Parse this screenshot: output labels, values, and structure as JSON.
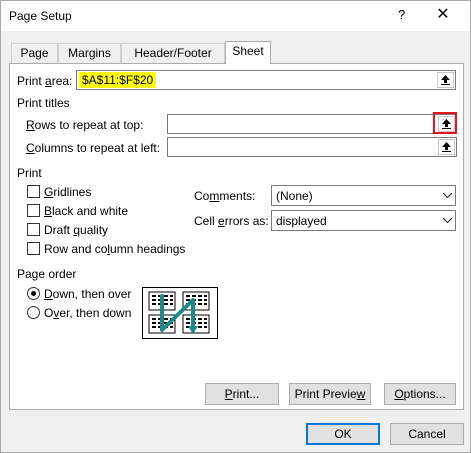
{
  "window": {
    "title": "Page Setup",
    "help": "?",
    "close": "✕"
  },
  "tabs": [
    {
      "label": "Page"
    },
    {
      "label": "Margins"
    },
    {
      "label": "Header/Footer"
    },
    {
      "label": "Sheet",
      "active": true
    }
  ],
  "print_area": {
    "label_pre": "Print ",
    "label_u": "a",
    "label_post": "rea:",
    "value": "$A$11:$F$20",
    "highlight_color": "#ffff00"
  },
  "print_titles": {
    "heading": "Print titles",
    "rows": {
      "label_u": "R",
      "label_post": "ows to repeat at top:",
      "value": ""
    },
    "columns": {
      "label_u": "C",
      "label_post": "olumns to repeat at left:",
      "value": ""
    }
  },
  "print": {
    "heading": "Print",
    "checkboxes": [
      {
        "u": "G",
        "rest": "ridlines",
        "checked": false
      },
      {
        "u": "B",
        "rest": "lack and white",
        "checked": false
      },
      {
        "pre": "Draft ",
        "u": "q",
        "rest": "uality",
        "checked": false
      },
      {
        "pre": "Row and co",
        "u": "l",
        "rest": "umn headings",
        "checked": false
      }
    ],
    "comments": {
      "pre": "Co",
      "u": "m",
      "rest": "ments:",
      "value": "(None)"
    },
    "cell_errors": {
      "pre": "Cell ",
      "u": "e",
      "rest": "rrors as:",
      "value": "displayed"
    }
  },
  "page_order": {
    "heading": "Page order",
    "down_then_over": {
      "u": "D",
      "rest": "own, then over",
      "selected": true
    },
    "over_then_down": {
      "pre": "O",
      "u": "v",
      "rest": "er, then down",
      "selected": false
    }
  },
  "buttons": {
    "print": {
      "u": "P",
      "rest": "rint..."
    },
    "print_preview": {
      "pre": "Print Previe",
      "u": "w",
      "rest": ""
    },
    "options": {
      "u": "O",
      "rest": "ptions..."
    },
    "ok": "OK",
    "cancel": "Cancel"
  },
  "colors": {
    "highlight_box": "#e8141c",
    "accent": "#0078d7",
    "preview_arrow": "#1a8a8a"
  }
}
